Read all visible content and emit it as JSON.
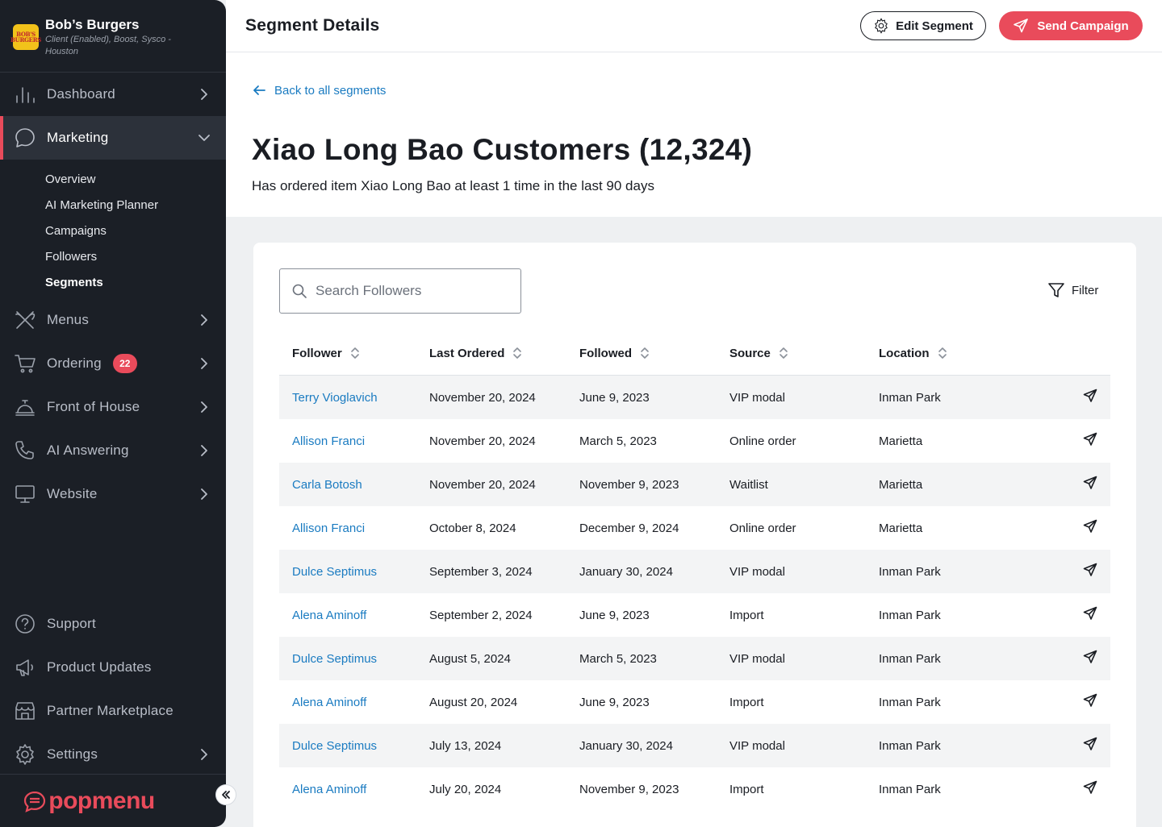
{
  "brand": {
    "logo_text": "BOB'S BURGERS",
    "name": "Bob’s Burgers",
    "subtitle": "Client (Enabled), Boost, Sysco - Houston"
  },
  "sidebar": {
    "items": [
      {
        "label": "Dashboard",
        "icon": "bar-chart-icon"
      },
      {
        "label": "Marketing",
        "icon": "chat-bubble-icon",
        "active": true,
        "expanded": true
      },
      {
        "label": "Menus",
        "icon": "utensils-icon"
      },
      {
        "label": "Ordering",
        "icon": "cart-icon",
        "badge": "22"
      },
      {
        "label": "Front of House",
        "icon": "service-bell-icon"
      },
      {
        "label": "AI Answering",
        "icon": "phone-icon"
      },
      {
        "label": "Website",
        "icon": "monitor-icon"
      }
    ],
    "marketing_subitems": [
      {
        "label": "Overview"
      },
      {
        "label": "AI Marketing Planner"
      },
      {
        "label": "Campaigns"
      },
      {
        "label": "Followers"
      },
      {
        "label": "Segments",
        "active": true
      }
    ],
    "bottom_items": [
      {
        "label": "Support",
        "icon": "question-circle-icon"
      },
      {
        "label": "Product Updates",
        "icon": "megaphone-icon"
      },
      {
        "label": "Partner Marketplace",
        "icon": "storefront-icon"
      },
      {
        "label": "Settings",
        "icon": "gear-icon"
      }
    ],
    "footer_logo": "popmenu"
  },
  "header": {
    "title": "Segment Details",
    "edit_label": "Edit Segment",
    "send_label": "Send Campaign"
  },
  "segment": {
    "back_label": "Back to all segments",
    "title": "Xiao Long Bao Customers (12,324)",
    "description": "Has ordered item Xiao Long Bao at least 1 time in the last 90 days"
  },
  "search": {
    "placeholder": "Search Followers",
    "value": ""
  },
  "filter_label": "Filter",
  "table": {
    "columns": [
      "Follower",
      "Last Ordered",
      "Followed",
      "Source",
      "Location"
    ],
    "rows": [
      {
        "follower": "Terry Vioglavich",
        "last_ordered": "November 20, 2024",
        "followed": "June 9, 2023",
        "source": "VIP modal",
        "location": "Inman Park"
      },
      {
        "follower": "Allison Franci",
        "last_ordered": "November 20, 2024",
        "followed": "March 5, 2023",
        "source": "Online order",
        "location": "Marietta"
      },
      {
        "follower": "Carla Botosh",
        "last_ordered": "November 20, 2024",
        "followed": "November 9, 2023",
        "source": "Waitlist",
        "location": "Marietta"
      },
      {
        "follower": "Allison Franci",
        "last_ordered": "October 8, 2024",
        "followed": "December 9, 2024",
        "source": "Online order",
        "location": "Marietta"
      },
      {
        "follower": "Dulce Septimus",
        "last_ordered": "September 3, 2024",
        "followed": "January 30, 2024",
        "source": "VIP modal",
        "location": "Inman Park"
      },
      {
        "follower": "Alena Aminoff",
        "last_ordered": "September 2, 2024",
        "followed": "June 9, 2023",
        "source": "Import",
        "location": "Inman Park"
      },
      {
        "follower": "Dulce Septimus",
        "last_ordered": "August 5, 2024",
        "followed": "March 5, 2023",
        "source": "VIP modal",
        "location": "Inman Park"
      },
      {
        "follower": "Alena Aminoff",
        "last_ordered": "August 20, 2024",
        "followed": "June 9, 2023",
        "source": "Import",
        "location": "Inman Park"
      },
      {
        "follower": "Dulce Septimus",
        "last_ordered": "July 13, 2024",
        "followed": "January 30, 2024",
        "source": "VIP modal",
        "location": "Inman Park"
      },
      {
        "follower": "Alena Aminoff",
        "last_ordered": "July 20, 2024",
        "followed": "November 9, 2023",
        "source": "Import",
        "location": "Inman Park"
      }
    ]
  },
  "colors": {
    "sidebar_bg": "#1b1f26",
    "accent": "#e94b5b",
    "link": "#1a7bc1",
    "page_bg": "#eef0f2"
  }
}
